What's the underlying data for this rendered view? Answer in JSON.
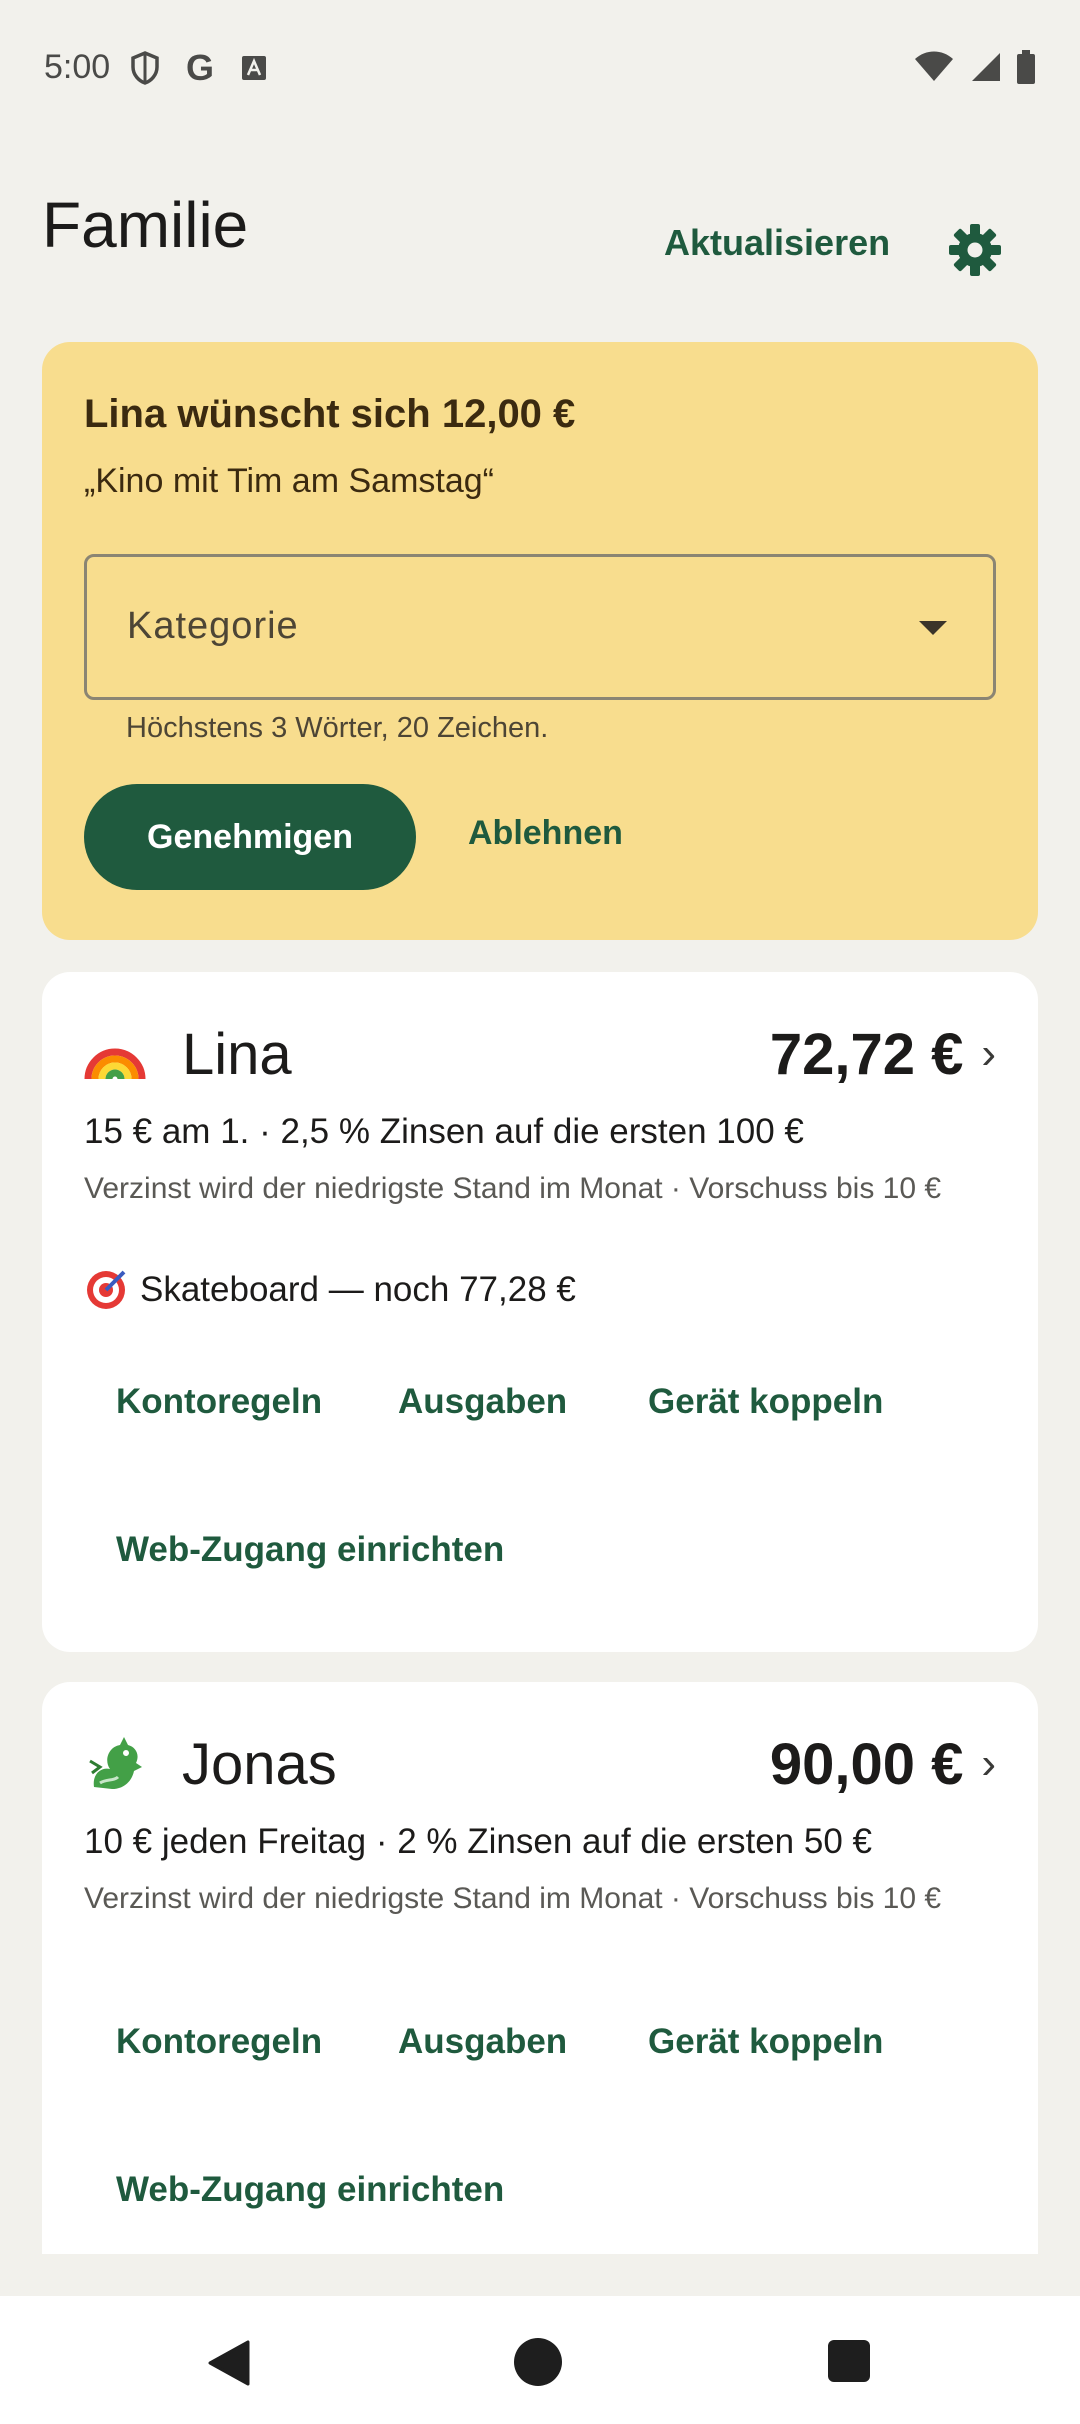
{
  "status_bar": {
    "time": "5:00",
    "icons_left": [
      "shield-icon",
      "google-icon",
      "text-icon"
    ],
    "icons_right": [
      "wifi-icon",
      "signal-icon",
      "battery-icon"
    ],
    "google_letter": "G"
  },
  "header": {
    "title": "Familie",
    "refresh_label": "Aktualisieren",
    "settings_icon": "gear-icon"
  },
  "colors": {
    "accent": "#1f5a3e",
    "request_bg": "#f8dd8e",
    "page_bg": "#f2f1ec"
  },
  "request": {
    "title": "Lina wünscht sich 12,00 €",
    "quote": "„Kino mit Tim am Samstag“",
    "category_placeholder": "Kategorie",
    "helper": "Höchstens 3 Wörter, 20 Zeichen.",
    "approve_label": "Genehmigen",
    "reject_label": "Ablehnen"
  },
  "children": [
    {
      "emoji": "🌈",
      "name": "Lina",
      "balance": "72,72 €",
      "chevron": "›",
      "rules": "15 € am 1. · 2,5 % Zinsen auf die ersten 100 €",
      "note": "Verzinst wird der niedrigste Stand im Monat · Vorschuss bis 10 €",
      "goal": "Skateboard — noch 77,28 €",
      "actions": [
        "Kontoregeln",
        "Ausgaben",
        "Gerät koppeln",
        "Web-Zugang einrichten"
      ]
    },
    {
      "emoji": "🐉",
      "name": "Jonas",
      "balance": "90,00 €",
      "chevron": "›",
      "rules": "10 € jeden Freitag · 2 % Zinsen auf die ersten 50 €",
      "note": "Verzinst wird der niedrigste Stand im Monat · Vorschuss bis 10 €",
      "actions": [
        "Kontoregeln",
        "Ausgaben",
        "Gerät koppeln",
        "Web-Zugang einrichten"
      ]
    }
  ],
  "nav": {
    "back": "back-icon",
    "home": "home-icon",
    "recents": "recents-icon"
  }
}
